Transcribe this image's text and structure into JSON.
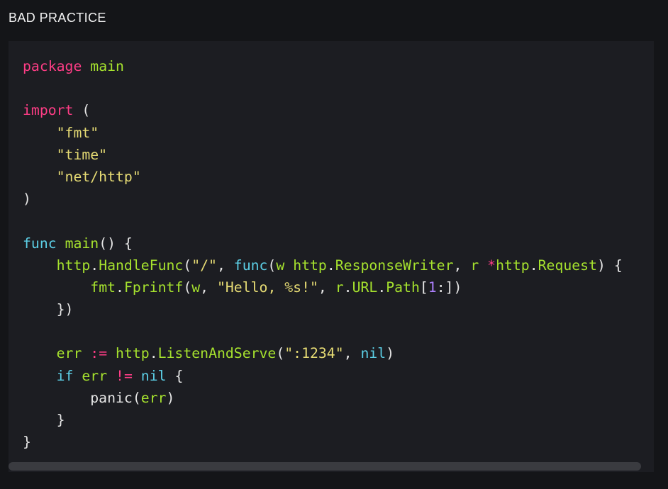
{
  "section": {
    "label": "BAD PRACTICE"
  },
  "code": {
    "language": "go",
    "lines": [
      [
        [
          "kw",
          "package"
        ],
        [
          "p",
          " "
        ],
        [
          "g",
          "main"
        ]
      ],
      [],
      [
        [
          "kw",
          "import"
        ],
        [
          "p",
          " ("
        ]
      ],
      [
        [
          "p",
          "    "
        ],
        [
          "s",
          "\"fmt\""
        ]
      ],
      [
        [
          "p",
          "    "
        ],
        [
          "s",
          "\"time\""
        ]
      ],
      [
        [
          "p",
          "    "
        ],
        [
          "s",
          "\"net/http\""
        ]
      ],
      [
        [
          "p",
          ")"
        ]
      ],
      [],
      [
        [
          "b",
          "func"
        ],
        [
          "p",
          " "
        ],
        [
          "g",
          "main"
        ],
        [
          "p",
          "() {"
        ]
      ],
      [
        [
          "p",
          "    "
        ],
        [
          "g",
          "http"
        ],
        [
          "p",
          "."
        ],
        [
          "g",
          "HandleFunc"
        ],
        [
          "p",
          "("
        ],
        [
          "s",
          "\"/\""
        ],
        [
          "p",
          ", "
        ],
        [
          "b",
          "func"
        ],
        [
          "p",
          "("
        ],
        [
          "g",
          "w"
        ],
        [
          "p",
          " "
        ],
        [
          "g",
          "http"
        ],
        [
          "p",
          "."
        ],
        [
          "g",
          "ResponseWriter"
        ],
        [
          "p",
          ", "
        ],
        [
          "g",
          "r"
        ],
        [
          "p",
          " "
        ],
        [
          "kw",
          "*"
        ],
        [
          "g",
          "http"
        ],
        [
          "p",
          "."
        ],
        [
          "g",
          "Request"
        ],
        [
          "p",
          ") {"
        ]
      ],
      [
        [
          "p",
          "        "
        ],
        [
          "g",
          "fmt"
        ],
        [
          "p",
          "."
        ],
        [
          "g",
          "Fprintf"
        ],
        [
          "p",
          "("
        ],
        [
          "g",
          "w"
        ],
        [
          "p",
          ", "
        ],
        [
          "s",
          "\"Hello, %s!\""
        ],
        [
          "p",
          ", "
        ],
        [
          "g",
          "r"
        ],
        [
          "p",
          "."
        ],
        [
          "g",
          "URL"
        ],
        [
          "p",
          "."
        ],
        [
          "g",
          "Path"
        ],
        [
          "p",
          "["
        ],
        [
          "n",
          "1"
        ],
        [
          "p",
          ":])"
        ]
      ],
      [
        [
          "p",
          "    })"
        ]
      ],
      [],
      [
        [
          "p",
          "    "
        ],
        [
          "g",
          "err"
        ],
        [
          "p",
          " "
        ],
        [
          "kw",
          ":="
        ],
        [
          "p",
          " "
        ],
        [
          "g",
          "http"
        ],
        [
          "p",
          "."
        ],
        [
          "g",
          "ListenAndServe"
        ],
        [
          "p",
          "("
        ],
        [
          "s",
          "\":1234\""
        ],
        [
          "p",
          ", "
        ],
        [
          "b",
          "nil"
        ],
        [
          "p",
          ")"
        ]
      ],
      [
        [
          "p",
          "    "
        ],
        [
          "b",
          "if"
        ],
        [
          "p",
          " "
        ],
        [
          "g",
          "err"
        ],
        [
          "p",
          " "
        ],
        [
          "kw",
          "!="
        ],
        [
          "p",
          " "
        ],
        [
          "b",
          "nil"
        ],
        [
          "p",
          " {"
        ]
      ],
      [
        [
          "p",
          "        panic("
        ],
        [
          "g",
          "err"
        ],
        [
          "p",
          ")"
        ]
      ],
      [
        [
          "p",
          "    }"
        ]
      ],
      [
        [
          "p",
          "}"
        ]
      ]
    ]
  },
  "colors": {
    "background": "#141518",
    "panel": "#1c1d22",
    "keyword": "#ff3d86",
    "builtin": "#5ccfe6",
    "identifier": "#a6e22e",
    "string": "#e6db74",
    "number": "#ae81ff",
    "plain": "#e6e6e6",
    "scrollbar": "#3a3b40"
  }
}
